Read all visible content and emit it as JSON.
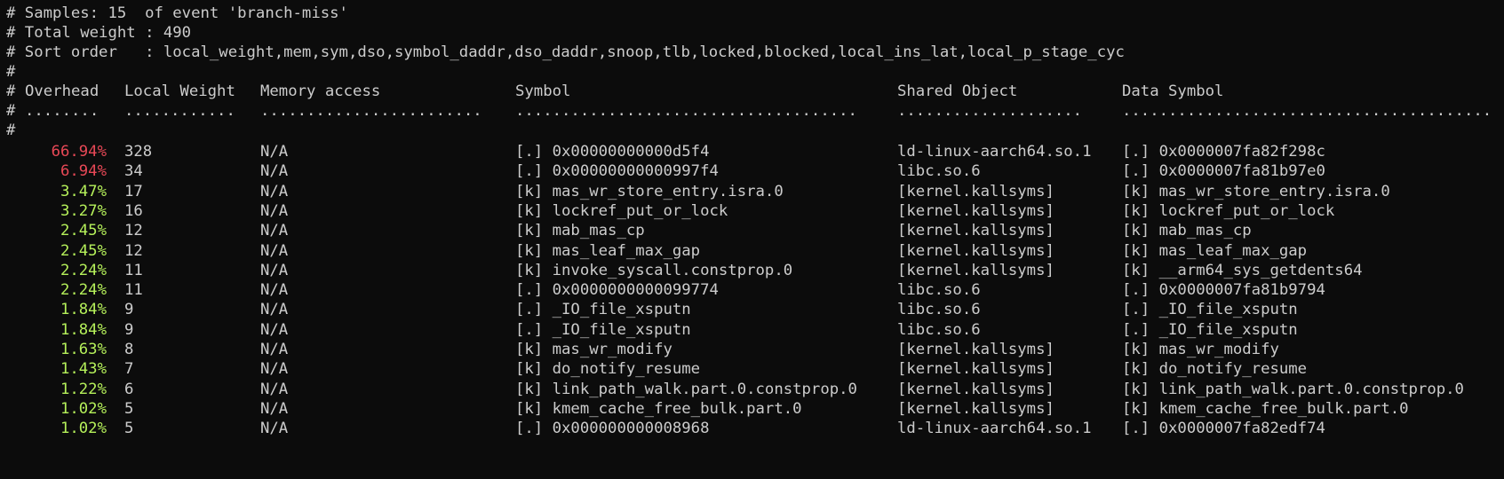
{
  "colors": {
    "background": "#0c0c0c",
    "text": "#cccccc",
    "overhead_high": "#e74856",
    "overhead_low": "#b5f05a"
  },
  "header": {
    "samples_line": "# Samples: 15  of event 'branch-miss'",
    "weight_line": "# Total weight : 490",
    "sort_line": "# Sort order   : local_weight,mem,sym,dso,symbol_daddr,dso_daddr,snoop,tlb,locked,blocked,local_ins_lat,local_p_stage_cyc",
    "blank_comment_1": "#",
    "blank_comment_2": "#"
  },
  "columns": {
    "hash": "#",
    "overhead": "Overhead",
    "local_weight": "Local Weight",
    "memory_access": "Memory access",
    "symbol": "Symbol",
    "shared_object": "Shared Object",
    "data_symbol": "Data Symbol",
    "dots_overhead": "........",
    "dots_local_weight": "............",
    "dots_memory_access": "........................",
    "dots_symbol": ".....................................",
    "dots_shared_object": "....................",
    "dots_data_symbol": "........................................"
  },
  "rows": [
    {
      "overhead": "66.94%",
      "level": "high",
      "weight": "328",
      "mem": "N/A",
      "symbol": "[.] 0x00000000000d5f4",
      "dso": "ld-linux-aarch64.so.1",
      "data_symbol": "[.] 0x0000007fa82f298c"
    },
    {
      "overhead": "6.94%",
      "level": "high",
      "weight": "34",
      "mem": "N/A",
      "symbol": "[.] 0x00000000000997f4",
      "dso": "libc.so.6",
      "data_symbol": "[.] 0x0000007fa81b97e0"
    },
    {
      "overhead": "3.47%",
      "level": "low",
      "weight": "17",
      "mem": "N/A",
      "symbol": "[k] mas_wr_store_entry.isra.0",
      "dso": "[kernel.kallsyms]",
      "data_symbol": "[k] mas_wr_store_entry.isra.0"
    },
    {
      "overhead": "3.27%",
      "level": "low",
      "weight": "16",
      "mem": "N/A",
      "symbol": "[k] lockref_put_or_lock",
      "dso": "[kernel.kallsyms]",
      "data_symbol": "[k] lockref_put_or_lock"
    },
    {
      "overhead": "2.45%",
      "level": "low",
      "weight": "12",
      "mem": "N/A",
      "symbol": "[k] mab_mas_cp",
      "dso": "[kernel.kallsyms]",
      "data_symbol": "[k] mab_mas_cp"
    },
    {
      "overhead": "2.45%",
      "level": "low",
      "weight": "12",
      "mem": "N/A",
      "symbol": "[k] mas_leaf_max_gap",
      "dso": "[kernel.kallsyms]",
      "data_symbol": "[k] mas_leaf_max_gap"
    },
    {
      "overhead": "2.24%",
      "level": "low",
      "weight": "11",
      "mem": "N/A",
      "symbol": "[k] invoke_syscall.constprop.0",
      "dso": "[kernel.kallsyms]",
      "data_symbol": "[k] __arm64_sys_getdents64"
    },
    {
      "overhead": "2.24%",
      "level": "low",
      "weight": "11",
      "mem": "N/A",
      "symbol": "[.] 0x0000000000099774",
      "dso": "libc.so.6",
      "data_symbol": "[.] 0x0000007fa81b9794"
    },
    {
      "overhead": "1.84%",
      "level": "low",
      "weight": "9",
      "mem": "N/A",
      "symbol": "[.] _IO_file_xsputn",
      "dso": "libc.so.6",
      "data_symbol": "[.] _IO_file_xsputn"
    },
    {
      "overhead": "1.84%",
      "level": "low",
      "weight": "9",
      "mem": "N/A",
      "symbol": "[.] _IO_file_xsputn",
      "dso": "libc.so.6",
      "data_symbol": "[.] _IO_file_xsputn"
    },
    {
      "overhead": "1.63%",
      "level": "low",
      "weight": "8",
      "mem": "N/A",
      "symbol": "[k] mas_wr_modify",
      "dso": "[kernel.kallsyms]",
      "data_symbol": "[k] mas_wr_modify"
    },
    {
      "overhead": "1.43%",
      "level": "low",
      "weight": "7",
      "mem": "N/A",
      "symbol": "[k] do_notify_resume",
      "dso": "[kernel.kallsyms]",
      "data_symbol": "[k] do_notify_resume"
    },
    {
      "overhead": "1.22%",
      "level": "low",
      "weight": "6",
      "mem": "N/A",
      "symbol": "[k] link_path_walk.part.0.constprop.0",
      "dso": "[kernel.kallsyms]",
      "data_symbol": "[k] link_path_walk.part.0.constprop.0"
    },
    {
      "overhead": "1.02%",
      "level": "low",
      "weight": "5",
      "mem": "N/A",
      "symbol": "[k] kmem_cache_free_bulk.part.0",
      "dso": "[kernel.kallsyms]",
      "data_symbol": "[k] kmem_cache_free_bulk.part.0"
    },
    {
      "overhead": "1.02%",
      "level": "low",
      "weight": "5",
      "mem": "N/A",
      "symbol": "[.] 0x000000000008968",
      "dso": "ld-linux-aarch64.so.1",
      "data_symbol": "[.] 0x0000007fa82edf74"
    }
  ]
}
